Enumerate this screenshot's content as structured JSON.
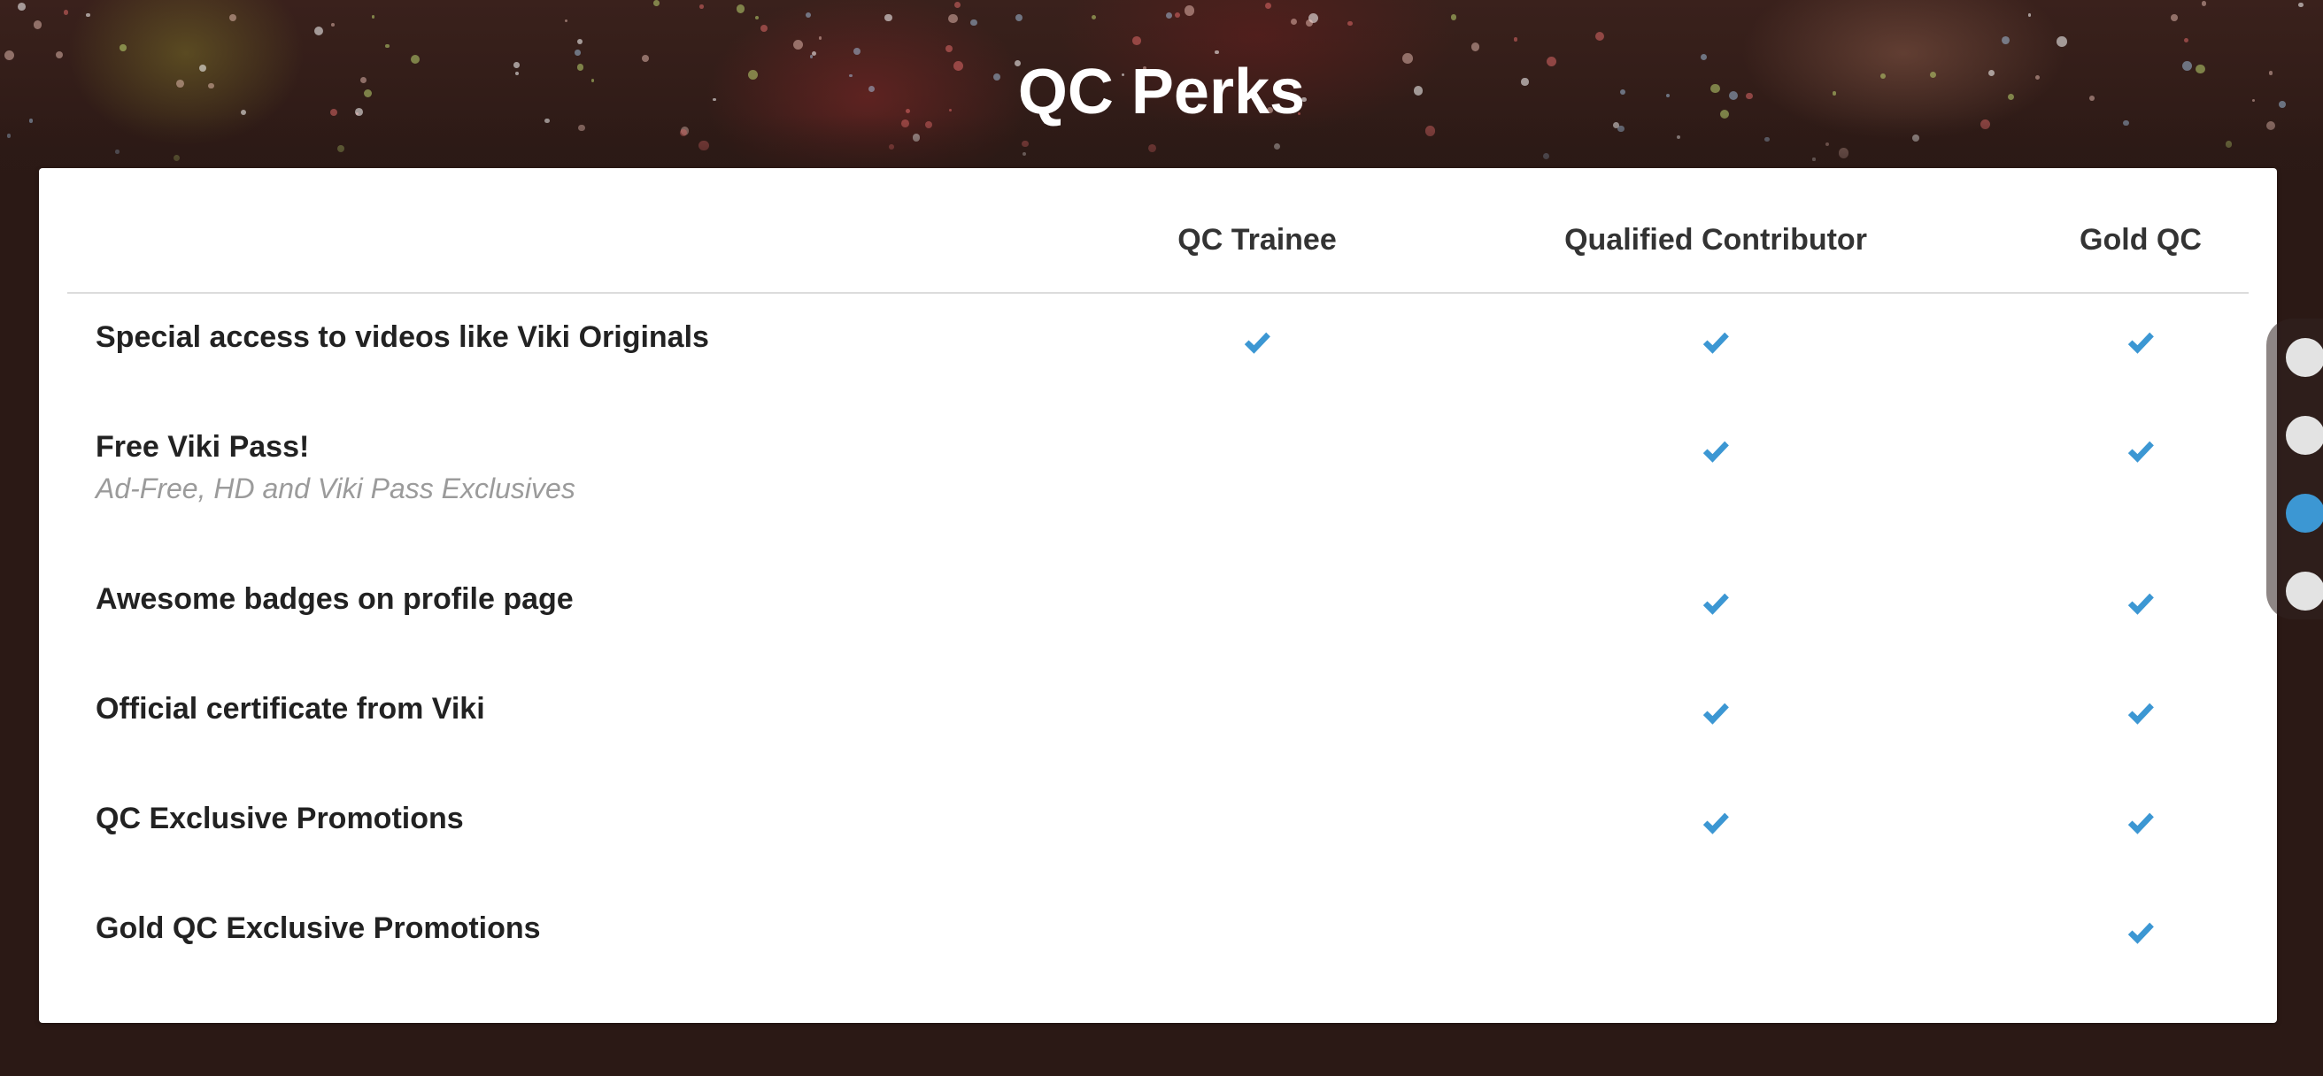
{
  "page": {
    "title": "QC Perks"
  },
  "table": {
    "columns": [
      "QC Trainee",
      "Qualified Contributor",
      "Gold QC"
    ],
    "rows": [
      {
        "label": "Special access to videos like Viki Originals",
        "sublabel": "",
        "checks": [
          true,
          true,
          true
        ]
      },
      {
        "label": "Free Viki Pass!",
        "sublabel": "Ad-Free, HD and Viki Pass Exclusives",
        "checks": [
          false,
          true,
          true
        ]
      },
      {
        "label": "Awesome badges on profile page",
        "sublabel": "",
        "checks": [
          false,
          true,
          true
        ]
      },
      {
        "label": "Official certificate from Viki",
        "sublabel": "",
        "checks": [
          false,
          true,
          true
        ]
      },
      {
        "label": "QC Exclusive Promotions",
        "sublabel": "",
        "checks": [
          false,
          true,
          true
        ]
      },
      {
        "label": "Gold QC Exclusive Promotions",
        "sublabel": "",
        "checks": [
          false,
          false,
          true
        ]
      }
    ]
  },
  "section_nav": {
    "dot_count": 4,
    "active_index": 2
  },
  "colors": {
    "check": "#3c97d3",
    "accent": "#3c97d3",
    "background": "#2b1915",
    "card": "#ffffff"
  },
  "icons": {
    "check": "checkmark-icon"
  }
}
